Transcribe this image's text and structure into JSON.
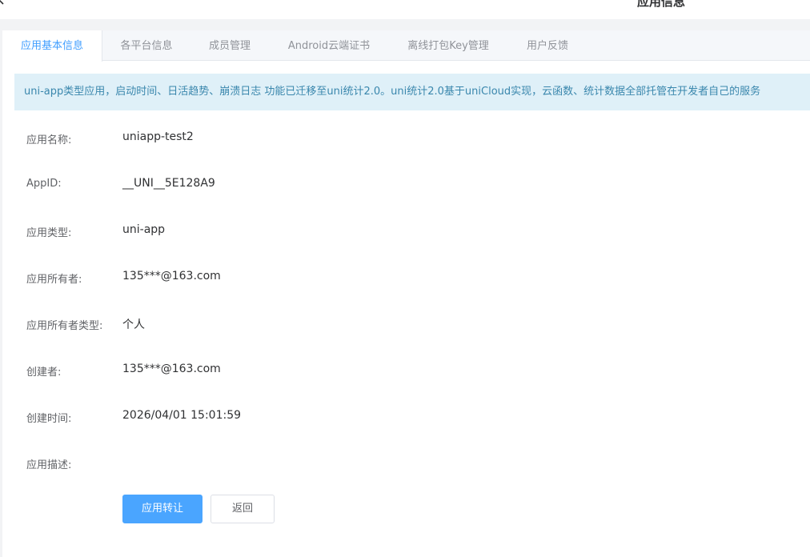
{
  "header": {
    "title": "应用信息",
    "back_icon": "chevron-left-icon"
  },
  "tabs": [
    {
      "label": "应用基本信息",
      "active": true
    },
    {
      "label": "各平台信息",
      "active": false
    },
    {
      "label": "成员管理",
      "active": false
    },
    {
      "label": "Android云端证书",
      "active": false
    },
    {
      "label": "离线打包Key管理",
      "active": false
    },
    {
      "label": "用户反馈",
      "active": false
    }
  ],
  "notice": {
    "text": "uni-app类型应用，启动时间、日活趋势、崩溃日志 功能已迁移至uni统计2.0。uni统计2.0基于uniCloud实现，云函数、统计数据全部托管在开发者自己的服务"
  },
  "fields": [
    {
      "label": "应用名称:",
      "value": "uniapp-test2"
    },
    {
      "label": "AppID:",
      "value": "__UNI__5E128A9"
    },
    {
      "label": "应用类型:",
      "value": "uni-app"
    },
    {
      "label": "应用所有者:",
      "value": "135***@163.com"
    },
    {
      "label": "应用所有者类型:",
      "value": "个人"
    },
    {
      "label": "创建者:",
      "value": "135***@163.com"
    },
    {
      "label": "创建时间:",
      "value": "2026/04/01 15:01:59"
    },
    {
      "label": "应用描述:",
      "value": ""
    }
  ],
  "actions": {
    "transfer_label": "应用转让",
    "back_label": "返回"
  },
  "colors": {
    "accent": "#409eff",
    "primary_button": "#4aa5ff",
    "notice_bg": "#dff0f8",
    "notice_text": "#3a87ad"
  }
}
